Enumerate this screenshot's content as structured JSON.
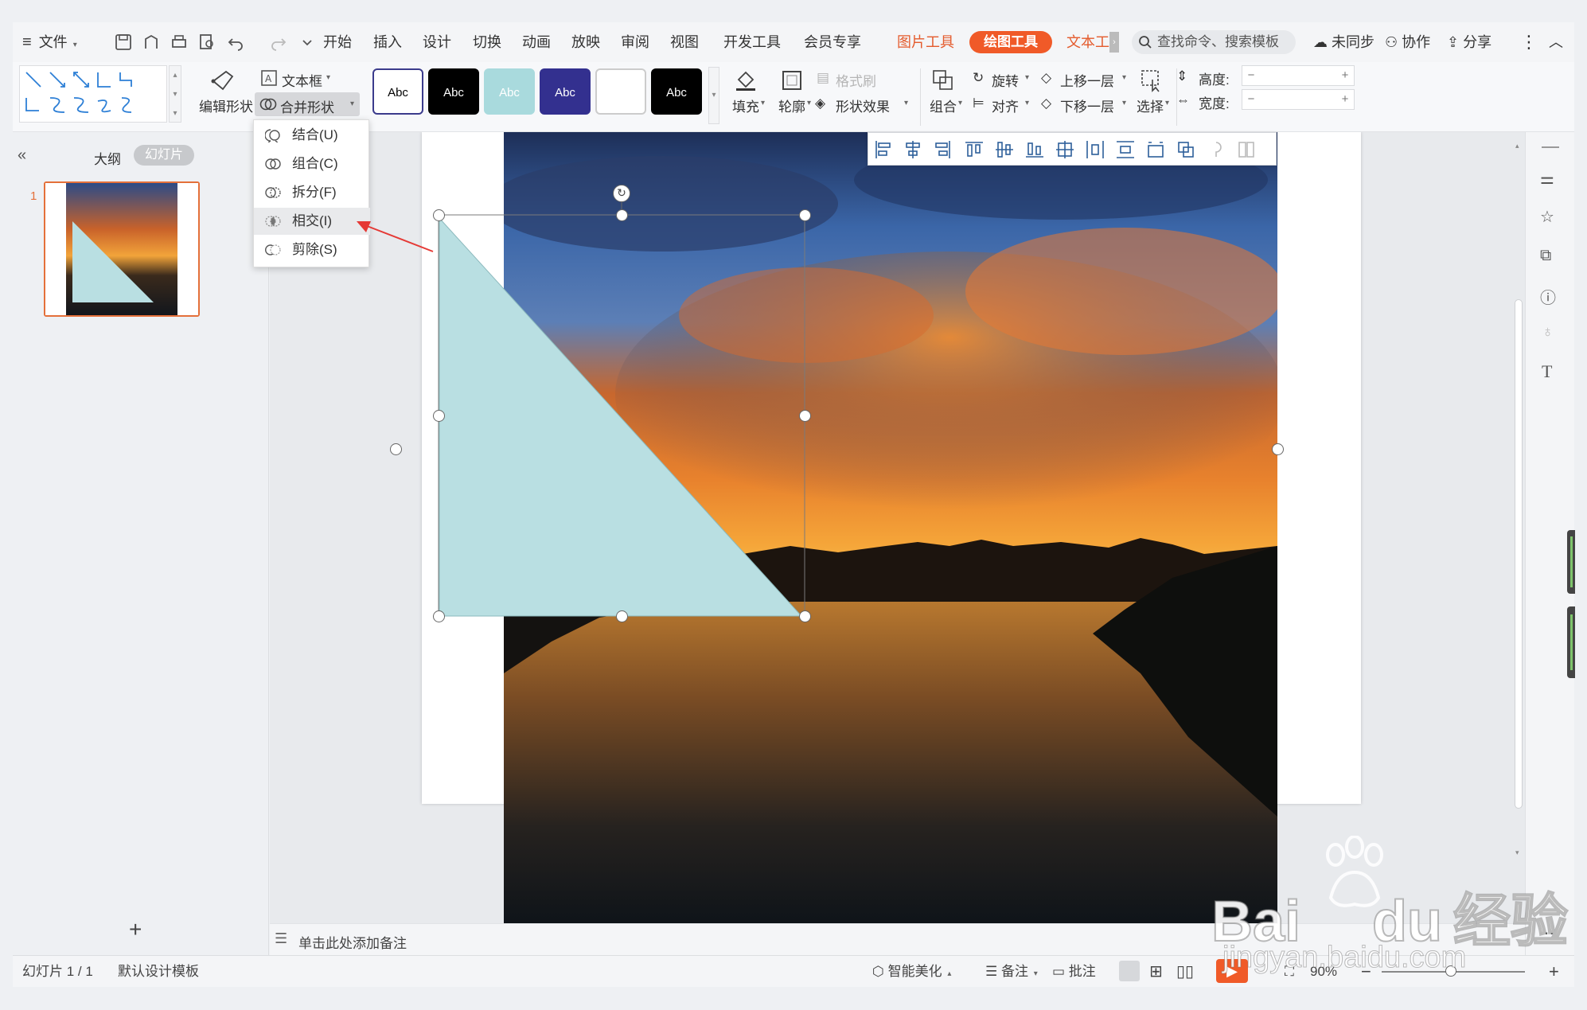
{
  "menubar": {
    "file_label": "文件",
    "tabs": [
      "开始",
      "插入",
      "设计",
      "切换",
      "动画",
      "放映",
      "审阅",
      "视图",
      "开发工具",
      "会员专享"
    ],
    "context_tabs": [
      "图片工具",
      "绘图工具",
      "文本工"
    ],
    "search_placeholder": "查找命令、搜索模板",
    "sync_label": "未同步",
    "collab_label": "协作",
    "share_label": "分享"
  },
  "ribbon": {
    "edit_shape": "编辑形状",
    "textbox": "文本框",
    "merge_shapes": "合并形状",
    "style_presets": [
      {
        "label": "Abc",
        "bg": "#ffffff",
        "fg": "#000000",
        "border": "#3b3b8c"
      },
      {
        "label": "Abc",
        "bg": "#000000",
        "fg": "#ffffff",
        "border": "#000000"
      },
      {
        "label": "Abc",
        "bg": "#a9dadd",
        "fg": "#ffffff",
        "border": "#a9dadd"
      },
      {
        "label": "Abc",
        "bg": "#33308f",
        "fg": "#ffffff",
        "border": "#33308f"
      },
      {
        "label": "",
        "bg": "#ffffff",
        "fg": "#000000",
        "border": "#cccccc"
      },
      {
        "label": "Abc",
        "bg": "#000000",
        "fg": "#ffffff",
        "border": "#000000"
      }
    ],
    "fill": "填充",
    "outline": "轮廓",
    "format_painter": "格式刷",
    "shape_effects": "形状效果",
    "group": "组合",
    "rotate": "旋转",
    "align": "对齐",
    "bring_forward": "上移一层",
    "send_backward": "下移一层",
    "select": "选择",
    "height_label": "高度:",
    "width_label": "宽度:"
  },
  "merge_menu": {
    "items": [
      "结合(U)",
      "组合(C)",
      "拆分(F)",
      "相交(I)",
      "剪除(S)"
    ],
    "highlighted_index": 3
  },
  "left_panel": {
    "outline_tab": "大纲",
    "slides_tab": "幻灯片",
    "slide_number": "1",
    "add_icon": "+"
  },
  "notes": {
    "placeholder": "单击此处添加备注"
  },
  "statusbar": {
    "slide_info": "幻灯片 1 / 1",
    "template": "默认设计模板",
    "smart_beautify": "智能美化",
    "notes_btn": "备注",
    "comments_btn": "批注",
    "zoom": "90%"
  },
  "watermark": {
    "line1": "Bai",
    "line1b": "du",
    "line1c": "经验",
    "line2": "jingyan.baidu.com"
  },
  "colors": {
    "accent": "#f05a28",
    "triangle_fill": "#b9dfe2",
    "selection_border": "#e4703a"
  }
}
